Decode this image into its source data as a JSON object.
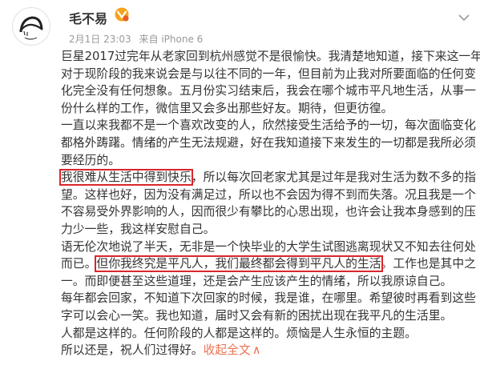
{
  "user": {
    "name": "毛不易",
    "date": "2月1日 23:03",
    "source": "来自 iPhone 6"
  },
  "post": {
    "lines": [
      [
        "巨星2017过完年从老家回到杭州感觉不是很愉快。我清楚地知道，接下来这一年"
      ],
      [
        "对于现阶段的我来说会是与以往不同的一年，但目前为止我对所要面临的任何变"
      ],
      [
        "化完全没有任何想象。五月份实习结束后，我会在哪个城市平凡地生活，从事一"
      ],
      [
        "份什么样的工作，微信里又会多出那些好友。期待，但更彷徨。"
      ],
      [
        "一直以来我都不是一个喜欢改变的人，欣然接受生活给予的一切，每次面临变化"
      ],
      [
        "都格外踌躇。情绪的产生无法规避，好在我知道接下来发生的一切都是我所必须"
      ],
      [
        "要经历的。"
      ],
      [
        "",
        "我很难从生活中得到快乐",
        "，所以每次回老家尤其是过年是我对生活为数不多的指"
      ],
      [
        "望。这样也好，因为没有满足过，所以也不会因为得不到而失落。况且我是一个"
      ],
      [
        "不容易受外界影响的人，因而很少有攀比的心思出现，也许会让我本身感到的压"
      ],
      [
        "力少一些，我这样安慰自己。"
      ],
      [
        "语无伦次地说了半天，无非是一个快毕业的大学生试图逃离现状又不知去往何处"
      ],
      [
        "而已。",
        "但你我终究是平凡人，我们最终都会得到平凡人的生活",
        "。工作也是其中之"
      ],
      [
        "一。而即便甚至这些道理，还是会产生应该产生的情绪，所以我原谅自己。"
      ],
      [
        "每年都会回家，不知道下次回家的时候，我是谁，在哪里。希望彼时再看到这些"
      ],
      [
        "字可以会心一笑。我也知道，届时又会有新的困扰出现在我平凡的生活里。"
      ],
      [
        "人都是这样的。任何阶段的人都是这样的。烦恼是人生永恒的主题。"
      ],
      [
        "所以还是，祝人们过得好。"
      ]
    ],
    "collapse_label": "收起全文",
    "collapse_arrow": "∧"
  }
}
